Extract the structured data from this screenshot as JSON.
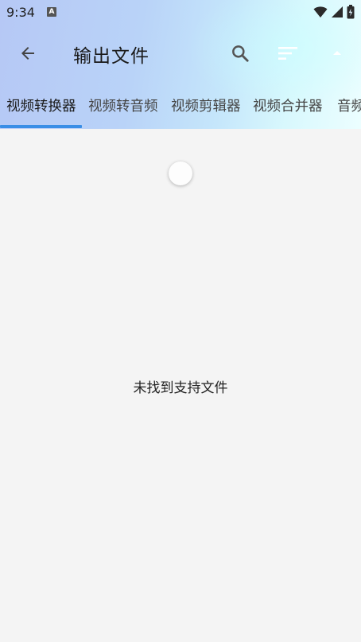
{
  "status": {
    "time": "9:34",
    "badge": "A"
  },
  "appbar": {
    "title": "输出文件",
    "back_icon": "arrow-left-icon",
    "search_icon": "search-icon",
    "sort_icon": "sort-icon",
    "menu_icon": "caret-up-icon"
  },
  "tabs": [
    {
      "label": "视频转换器",
      "active": true
    },
    {
      "label": "视频转音频",
      "active": false
    },
    {
      "label": "视频剪辑器",
      "active": false
    },
    {
      "label": "视频合并器",
      "active": false
    },
    {
      "label": "音频",
      "active": false
    }
  ],
  "content": {
    "empty_message": "未找到支持文件"
  },
  "colors": {
    "accent": "#3a8ee6",
    "background": "#f4f4f4"
  }
}
